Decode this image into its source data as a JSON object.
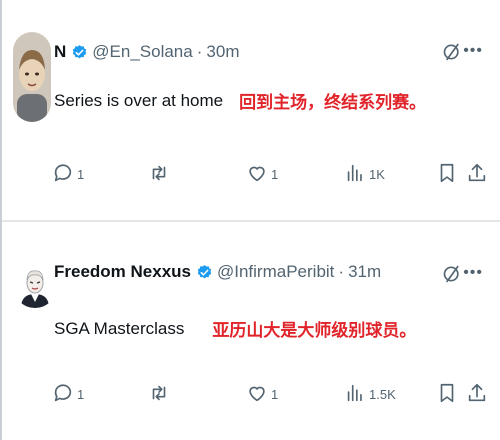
{
  "tweets": [
    {
      "name": "N",
      "handle": "@En_Solana",
      "separator": "·",
      "time": "30m",
      "text": "Series is over at home",
      "translation": "回到主场，终结系列赛。",
      "replies": "1",
      "reposts": "",
      "likes": "1",
      "views": "1K"
    },
    {
      "name": "Freedom Nexxus",
      "handle": "@InfirmaPeribit",
      "separator": "·",
      "time": "31m",
      "text": "SGA Masterclass",
      "translation": "亚历山大是大师级别球员。",
      "replies": "1",
      "reposts": "",
      "likes": "1",
      "views": "1.5K"
    }
  ],
  "colors": {
    "verified": "#1d9bf0",
    "translation": "#e0242a",
    "muted": "#536471"
  },
  "icons": [
    "verified-badge-icon",
    "grok-icon",
    "more-icon",
    "reply-icon",
    "repost-icon",
    "like-icon",
    "views-icon",
    "bookmark-icon",
    "share-icon"
  ]
}
